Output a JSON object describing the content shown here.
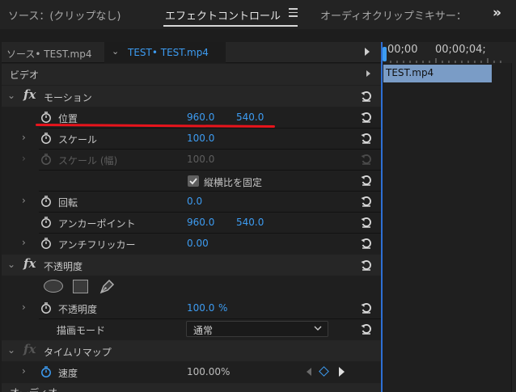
{
  "tabs": {
    "source": "ソース：(クリップなし)",
    "effect_controls": "エフェクトコントロール",
    "audio_mixer": "オーディオクリップミキサー："
  },
  "subtabs": {
    "source": "ソース• TEST.mp4",
    "sequence": "TEST• TEST.mp4"
  },
  "sections": {
    "video": "ビデオ",
    "motion": "モーション",
    "opacity": "不透明度",
    "time_remap": "タイムリマップ",
    "audio": "オーディオ"
  },
  "properties": {
    "position": {
      "label": "位置",
      "x": "960.0",
      "y": "540.0"
    },
    "scale": {
      "label": "スケール",
      "value": "100.0"
    },
    "scale_width": {
      "label": "スケール (幅)",
      "value": "100.0"
    },
    "uniform_scale": {
      "label": "縦横比を固定",
      "checked": true
    },
    "rotation": {
      "label": "回転",
      "value": "0.0"
    },
    "anchor": {
      "label": "アンカーポイント",
      "x": "960.0",
      "y": "540.0"
    },
    "antiflicker": {
      "label": "アンチフリッカー",
      "value": "0.00"
    },
    "opacity": {
      "label": "不透明度",
      "value": "100.0",
      "unit": "%"
    },
    "blend_mode": {
      "label": "描画モード",
      "value": "通常"
    },
    "speed": {
      "label": "速度",
      "value": "100.00%"
    }
  },
  "timeline": {
    "tc_start": "00;00",
    "tc_next": "00;00;04;",
    "clip_name": "TEST.mp4"
  },
  "colors": {
    "accent": "#3d9cf2",
    "annotation": "#e8141c",
    "clip": "#7a9cc6"
  }
}
